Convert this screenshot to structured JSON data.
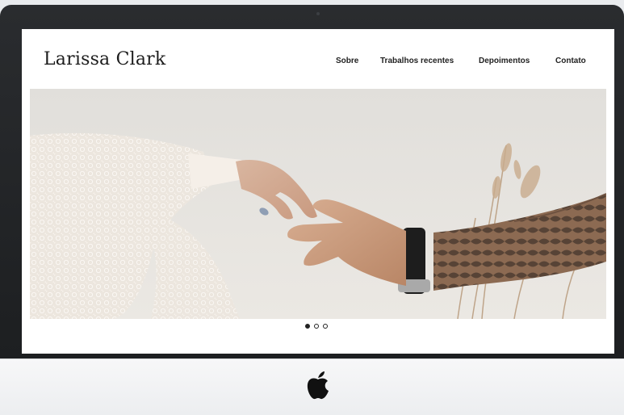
{
  "site": {
    "brand": "Larissa Clark"
  },
  "nav": {
    "items": [
      "Sobre",
      "Trabalhos recentes",
      "Depoimentos",
      "Contato"
    ]
  },
  "carousel": {
    "total_slides": 3,
    "active_index": 0
  },
  "colors": {
    "screen_bg": "#ffffff",
    "text": "#222222",
    "bezel": "#1f2123",
    "chin": "#f2f3f4"
  },
  "icons": {
    "device_logo": "apple-logo"
  }
}
